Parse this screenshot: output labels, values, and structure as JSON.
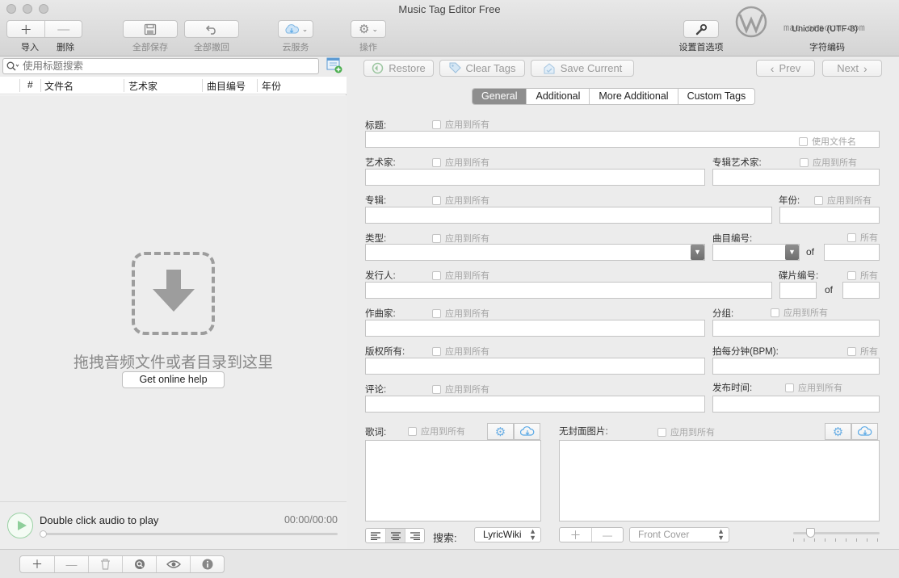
{
  "window": {
    "title": "Music Tag Editor Free"
  },
  "toolbar": {
    "import_label": "导入",
    "delete_label": "删除",
    "save_all_label": "全部保存",
    "revert_all_label": "全部撤回",
    "cloud_label": "云服务",
    "actions_label": "操作",
    "preferences_label": "设置首选项",
    "encoding_label": "字符编码",
    "encoding_value": "Unicode (UTF-8)"
  },
  "watermark": {
    "text": "mac.orsoon.com"
  },
  "left": {
    "search_placeholder": "使用标题搜索",
    "columns": [
      "#",
      "文件名",
      "艺术家",
      "曲目编号",
      "年份"
    ],
    "drop_text": "拖拽音频文件或者目录到这里",
    "help_button": "Get online help",
    "player_text": "Double click audio to play",
    "player_time": "00:00/00:00",
    "progress": 0
  },
  "actions": {
    "restore": "Restore",
    "clear_tags": "Clear Tags",
    "save_current": "Save Current",
    "prev": "Prev",
    "next": "Next"
  },
  "tabs": [
    "General",
    "Additional",
    "More Additional",
    "Custom Tags"
  ],
  "active_tab": "General",
  "fields": {
    "title": "标题:",
    "artist": "艺术家:",
    "album_artist": "专辑艺术家:",
    "album": "专辑:",
    "year": "年份:",
    "genre": "类型:",
    "track_number": "曲目编号:",
    "publisher": "发行人:",
    "disc_number": "碟片编号:",
    "composer": "作曲家:",
    "grouping": "分组:",
    "copyright": "版权所有:",
    "bpm": "拍每分钟(BPM):",
    "comment": "评论:",
    "release_time": "发布时间:",
    "lyrics": "歌词:",
    "cover": "无封面图片:",
    "of": "of"
  },
  "checks": {
    "apply_all": "应用到所有",
    "all": "所有",
    "use_filename": "使用文件名"
  },
  "lyrics_search": {
    "label": "搜索:",
    "source": "LyricWiki"
  },
  "cover": {
    "type": "Front Cover",
    "zoom": 0.2
  },
  "colors": {
    "tab_active": "#8e8e8e",
    "play_green": "#9ad1a4",
    "cloud_blue": "#5aa9e6"
  }
}
